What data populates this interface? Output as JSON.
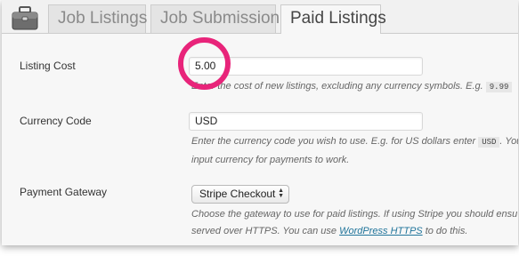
{
  "tabs": [
    {
      "label": "Job Listings",
      "active": false
    },
    {
      "label": "Job Submission",
      "active": false
    },
    {
      "label": "Paid Listings",
      "active": true
    }
  ],
  "settings": {
    "listing_cost": {
      "label": "Listing Cost",
      "value": "5.00",
      "desc_prefix": "Enter the cost of new listings, excluding any currency symbols. E.g.",
      "desc_code": "9.99"
    },
    "currency_code": {
      "label": "Currency Code",
      "value": "USD",
      "desc_line1_prefix": "Enter the currency code you wish to use. E.g. for US dollars enter",
      "desc_code": "USD",
      "desc_line1_suffix": ". You",
      "desc_line2": "input currency for payments to work."
    },
    "payment_gateway": {
      "label": "Payment Gateway",
      "selected": "Stripe Checkout",
      "desc_line1": "Choose the gateway to use for paid listings. If using Stripe you should ensu",
      "desc_line2_prefix": "served over HTTPS. You can use",
      "desc_link": "WordPress HTTPS",
      "desc_line2_suffix": "to do this."
    }
  },
  "colors": {
    "highlight_circle": "#e8247a",
    "link": "#21759b"
  },
  "icons": {
    "tabbar_logo": "briefcase-icon",
    "select_arrows": "updown-arrows-icon"
  }
}
